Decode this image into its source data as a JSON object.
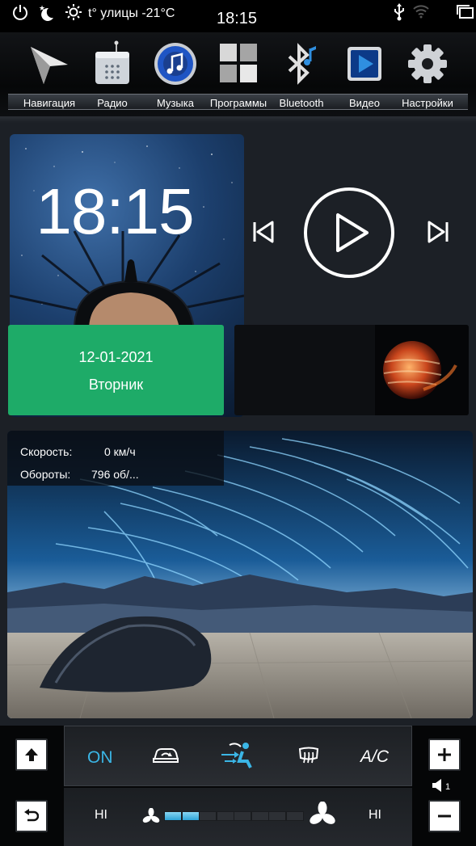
{
  "statusbar": {
    "outside_temp": "t° улицы -21°C",
    "clock": "18:15",
    "icons": [
      "power-icon",
      "night-mode-icon",
      "brightness-icon",
      "usb-icon",
      "wifi-icon",
      "recent-apps-icon"
    ]
  },
  "launcher": {
    "apps": [
      {
        "label": "Навигация",
        "icon": "navigation-arrow-icon"
      },
      {
        "label": "Радио",
        "icon": "radio-icon"
      },
      {
        "label": "Музыка",
        "icon": "music-note-icon"
      },
      {
        "label": "Программы",
        "icon": "apps-grid-icon"
      },
      {
        "label": "Bluetooth",
        "icon": "bluetooth-icon"
      },
      {
        "label": "Видео",
        "icon": "video-play-icon"
      },
      {
        "label": "Настройки",
        "icon": "gear-icon"
      }
    ]
  },
  "clock_widget": {
    "time": "18:15",
    "date": "12-01-2021",
    "weekday": "Вторник"
  },
  "music_widget": {
    "controls": [
      "previous-track-icon",
      "play-icon",
      "next-track-icon"
    ]
  },
  "vehicle_stats": {
    "speed_label": "Скорость:",
    "speed_value": "0 км/ч",
    "rpm_label": "Обороты:",
    "rpm_value": "796 об/..."
  },
  "climate": {
    "power_label": "ON",
    "ac_label": "A/C",
    "left_fan_label": "HI",
    "right_fan_label": "HI",
    "fan_level": 2,
    "fan_levels_total": 8,
    "volume_level": "1",
    "colors": {
      "active": "#3bb6e6",
      "date_card": "#1eab68"
    }
  }
}
